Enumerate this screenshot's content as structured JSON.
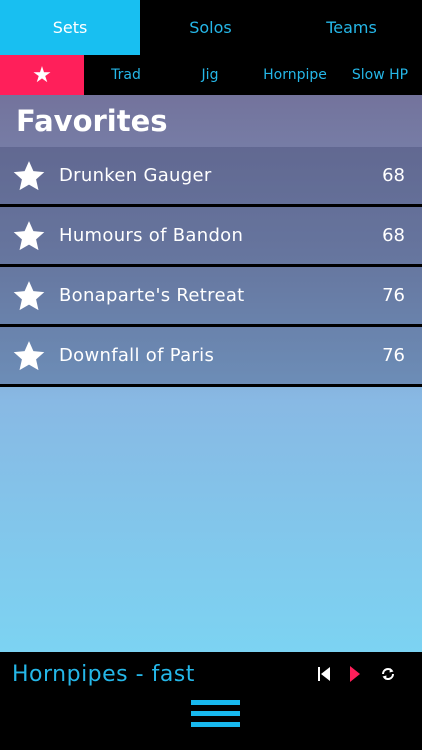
{
  "top_tabs": [
    {
      "label": "Sets",
      "active": true
    },
    {
      "label": "Solos",
      "active": false
    },
    {
      "label": "Teams",
      "active": false
    }
  ],
  "sub_tabs": [
    {
      "label": "★",
      "icon": "star-icon",
      "active": true
    },
    {
      "label": "Trad",
      "active": false
    },
    {
      "label": "Jig",
      "active": false
    },
    {
      "label": "Hornpipe",
      "active": false
    },
    {
      "label": "Slow HP",
      "active": false
    }
  ],
  "favorites": {
    "title": "Favorites",
    "items": [
      {
        "name": "Drunken Gauger",
        "bpm": "68"
      },
      {
        "name": "Humours of Bandon",
        "bpm": "68"
      },
      {
        "name": "Bonaparte's Retreat",
        "bpm": "76"
      },
      {
        "name": "Downfall of Paris",
        "bpm": "76"
      }
    ]
  },
  "player": {
    "now_playing": "Hornpipes - fast",
    "controls": [
      "skip-back-icon",
      "play-icon",
      "repeat-icon"
    ]
  },
  "menu": {
    "icon": "hamburger-menu-icon"
  },
  "colors": {
    "accent_blue": "#18bff1",
    "accent_pink": "#ff1f5a",
    "text_blue": "#25b7e8",
    "background": "#000000"
  }
}
